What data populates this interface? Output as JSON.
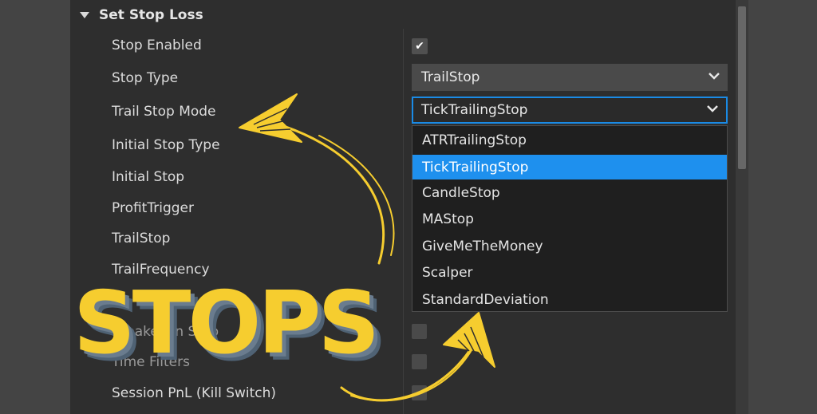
{
  "section": {
    "title": "Set Stop Loss",
    "icon": "collapse-triangle-icon"
  },
  "properties": [
    "Stop Enabled",
    "Stop Type",
    "Trail Stop Mode",
    "Initial Stop Type",
    "Initial Stop",
    "ProfitTrigger",
    "TrailStop",
    "TrailFrequency"
  ],
  "hidden_properties": [
    "Breakeven Stop",
    "Time Filters",
    "Session PnL (Kill Switch)"
  ],
  "values": {
    "stop_enabled": true,
    "stop_type": "TrailStop",
    "trail_stop_mode": "TickTrailingStop"
  },
  "dropdown": {
    "options": [
      "ATRTrailingStop",
      "TickTrailingStop",
      "CandleStop",
      "MAStop",
      "GiveMeTheMoney",
      "Scalper",
      "StandardDeviation"
    ],
    "selected_index": 1
  },
  "overlay_text": "STOPS",
  "colors": {
    "panel": "#2e2e2e",
    "selection": "#1e90ee",
    "focus_border": "#1a8be6",
    "annotation": "#f6cd2f"
  }
}
